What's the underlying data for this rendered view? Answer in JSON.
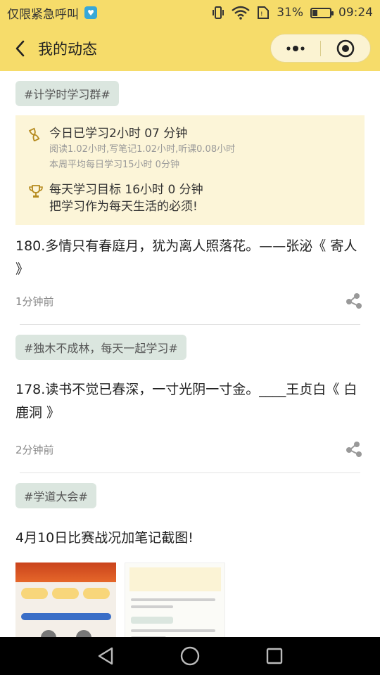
{
  "status_bar": {
    "carrier": "仅限紧急呼叫",
    "battery_percent": "31%",
    "battery_level": 0.31,
    "time": "09:24",
    "icons": [
      "vibrate-icon",
      "wifi-icon",
      "sim-icon",
      "battery-icon"
    ]
  },
  "header": {
    "title": "我的动态",
    "back_icon": "chevron-left-icon",
    "more_icon": "more-dots-icon",
    "close_icon": "target-circle-icon"
  },
  "posts": [
    {
      "tag": "#计学时学习群#",
      "study": {
        "today_main": "今日已学习2小时 07 分钟",
        "today_sub1": "阅读1.02小时,写笔记1.02小时,听课0.08小时",
        "today_sub2": "本周平均每日学习15小时 0分钟",
        "goal_main": "每天学习目标 16小时 0 分钟",
        "goal_sub": "把学习作为每天生活的必须!"
      },
      "text": "180.多情只有春庭月，犹为离人照落花。——张泌《 寄人 》",
      "time": "1分钟前"
    },
    {
      "tag": "#独木不成林，每天一起学习#",
      "text": "178.读书不觉已春深，一寸光阴一寸金。____王贞白《 白鹿洞 》",
      "time": "2分钟前"
    },
    {
      "tag": "#学道大会#",
      "text": "4月10日比赛战况加笔记截图!"
    }
  ],
  "colors": {
    "header_bg": "#f6dc6a",
    "tag_bg": "#dbe6df",
    "study_card_bg": "#fcf5d8",
    "nav_bg": "#000000"
  },
  "nav": {
    "icons": [
      "back-triangle-icon",
      "home-circle-icon",
      "recents-square-icon"
    ]
  }
}
